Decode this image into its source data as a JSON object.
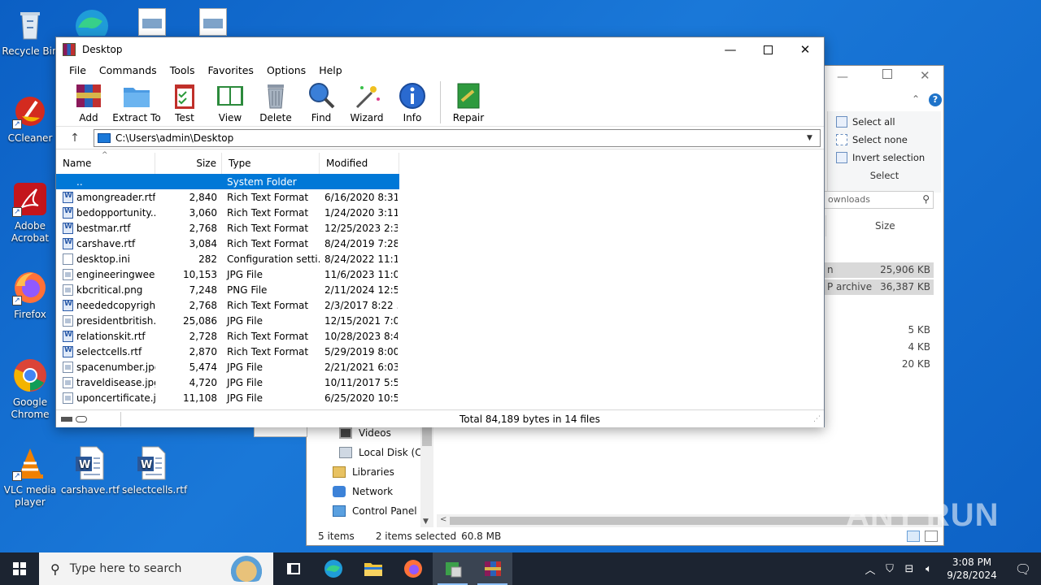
{
  "desktop": {
    "icons": [
      {
        "label": "Recycle Bin"
      },
      {
        "label": "CCleaner"
      },
      {
        "label": "Adobe Acrobat"
      },
      {
        "label": "Firefox"
      },
      {
        "label": "Google Chrome"
      },
      {
        "label": "VLC media player"
      },
      {
        "label": "carshave.rtf"
      },
      {
        "label": "selectcells.rtf"
      }
    ]
  },
  "explorer": {
    "ribbon": {
      "select_all": "Select all",
      "select_none": "Select none",
      "invert_selection": "Invert selection",
      "group_label": "Select"
    },
    "search_placeholder": "ownloads",
    "col_size": "Size",
    "rows": [
      {
        "type": "n",
        "size": "25,906 KB"
      },
      {
        "type": "P archive",
        "size": "36,387 KB"
      },
      {
        "type": "",
        "size": "5 KB"
      },
      {
        "type": "",
        "size": "4 KB"
      },
      {
        "type": "",
        "size": "20 KB"
      }
    ],
    "nav": [
      "Videos",
      "Local Disk (C:)",
      "Libraries",
      "Network",
      "Control Panel"
    ],
    "status": {
      "items": "5 items",
      "selected": "2 items selected",
      "size": "60.8 MB"
    }
  },
  "rar": {
    "title": "Desktop",
    "menu": [
      "File",
      "Commands",
      "Tools",
      "Favorites",
      "Options",
      "Help"
    ],
    "toolbar": [
      "Add",
      "Extract To",
      "Test",
      "View",
      "Delete",
      "Find",
      "Wizard",
      "Info",
      "Repair"
    ],
    "address": "C:\\Users\\admin\\Desktop",
    "columns": {
      "name": "Name",
      "size": "Size",
      "type": "Type",
      "modified": "Modified"
    },
    "files": [
      {
        "name": "..",
        "size": "",
        "type": "System Folder",
        "modified": "",
        "icon": "folder"
      },
      {
        "name": "amongreader.rtf",
        "size": "2,840",
        "type": "Rich Text Format",
        "modified": "6/16/2020 8:31 ...",
        "icon": "rtf"
      },
      {
        "name": "bedopportunity....",
        "size": "3,060",
        "type": "Rich Text Format",
        "modified": "1/24/2020 3:11 ...",
        "icon": "rtf"
      },
      {
        "name": "bestmar.rtf",
        "size": "2,768",
        "type": "Rich Text Format",
        "modified": "12/25/2023 2:3...",
        "icon": "rtf"
      },
      {
        "name": "carshave.rtf",
        "size": "3,084",
        "type": "Rich Text Format",
        "modified": "8/24/2019 7:28 ...",
        "icon": "rtf"
      },
      {
        "name": "desktop.ini",
        "size": "282",
        "type": "Configuration setti...",
        "modified": "8/24/2022 11:1...",
        "icon": "ini"
      },
      {
        "name": "engineeringwee...",
        "size": "10,153",
        "type": "JPG File",
        "modified": "11/6/2023 11:0...",
        "icon": "img"
      },
      {
        "name": "kbcritical.png",
        "size": "7,248",
        "type": "PNG File",
        "modified": "2/11/2024 12:5...",
        "icon": "img"
      },
      {
        "name": "neededcopyrigh...",
        "size": "2,768",
        "type": "Rich Text Format",
        "modified": "2/3/2017 8:22 ...",
        "icon": "rtf"
      },
      {
        "name": "presidentbritish....",
        "size": "25,086",
        "type": "JPG File",
        "modified": "12/15/2021 7:0...",
        "icon": "img"
      },
      {
        "name": "relationskit.rtf",
        "size": "2,728",
        "type": "Rich Text Format",
        "modified": "10/28/2023 8:4...",
        "icon": "rtf"
      },
      {
        "name": "selectcells.rtf",
        "size": "2,870",
        "type": "Rich Text Format",
        "modified": "5/29/2019 8:00 ...",
        "icon": "rtf"
      },
      {
        "name": "spacenumber.jpg",
        "size": "5,474",
        "type": "JPG File",
        "modified": "2/21/2021 6:03 ...",
        "icon": "img"
      },
      {
        "name": "traveldisease.jpg",
        "size": "4,720",
        "type": "JPG File",
        "modified": "10/11/2017 5:5...",
        "icon": "img"
      },
      {
        "name": "uponcertificate.j...",
        "size": "11,108",
        "type": "JPG File",
        "modified": "6/25/2020 10:5...",
        "icon": "img"
      }
    ],
    "status": "Total 84,189 bytes in 14 files"
  },
  "taskbar": {
    "search_placeholder": "Type here to search",
    "time": "3:08 PM",
    "date": "9/28/2024"
  },
  "watermark": "ANY RUN"
}
